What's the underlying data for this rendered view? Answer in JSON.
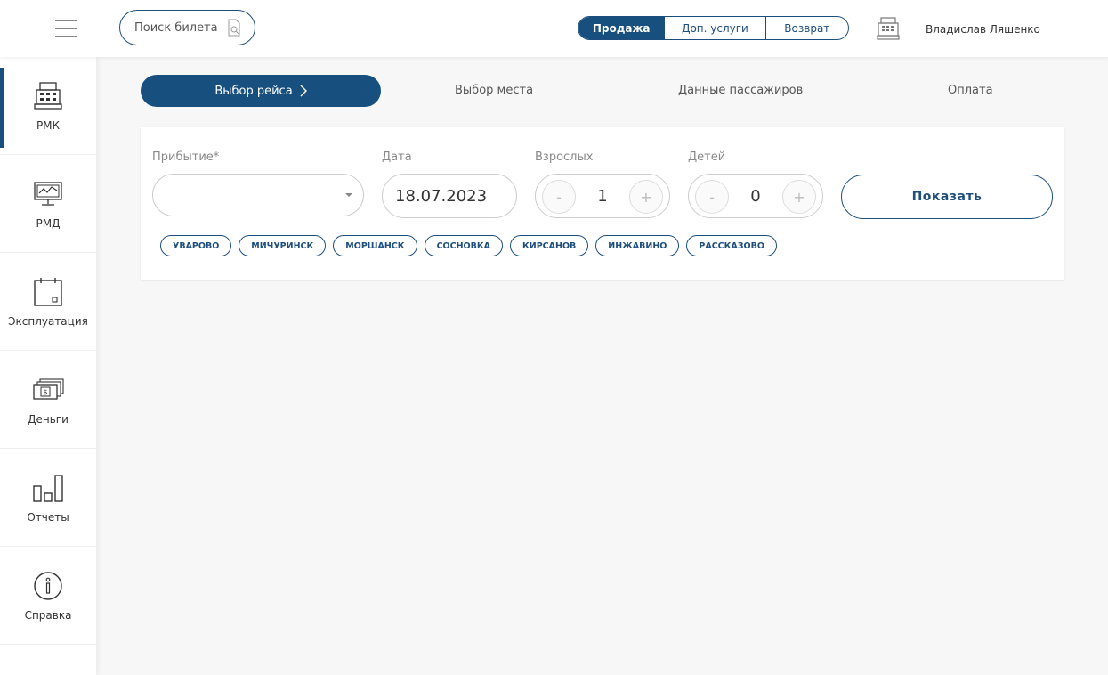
{
  "topbar": {
    "search_ticket_label": "Поиск билета",
    "modes": [
      {
        "label": "Продажа",
        "active": true
      },
      {
        "label": "Доп. услуги",
        "active": false
      },
      {
        "label": "Возврат",
        "active": false
      }
    ],
    "username": "Владислав Ляшенко"
  },
  "sidebar": {
    "items": [
      {
        "label": "РМК",
        "icon": "cash-register-icon",
        "active": true
      },
      {
        "label": "РМД",
        "icon": "monitor-icon",
        "active": false
      },
      {
        "label": "Эксплуатация",
        "icon": "calendar-icon",
        "active": false
      },
      {
        "label": "Деньги",
        "icon": "money-icon",
        "active": false
      },
      {
        "label": "Отчеты",
        "icon": "bar-chart-icon",
        "active": false
      },
      {
        "label": "Справка",
        "icon": "info-icon",
        "active": false
      }
    ]
  },
  "steps": {
    "items": [
      {
        "label": "Выбор рейса",
        "active": true
      },
      {
        "label": "Выбор места",
        "active": false
      },
      {
        "label": "Данные пассажиров",
        "active": false
      },
      {
        "label": "Оплата",
        "active": false
      }
    ]
  },
  "form": {
    "arrival_label": "Прибытие*",
    "arrival_value": "",
    "date_label": "Дата",
    "date_value": "18.07.2023",
    "adults_label": "Взрослых",
    "adults_value": "1",
    "children_label": "Детей",
    "children_value": "0",
    "minus": "-",
    "plus": "+",
    "show_button": "Показать"
  },
  "quick_destinations": [
    "УВАРОВО",
    "МИЧУРИНСК",
    "МОРШАНСК",
    "СОСНОВКА",
    "КИРСАНОВ",
    "ИНЖАВИНО",
    "РАССКАЗОВО"
  ],
  "colors": {
    "primary": "#17507f",
    "background": "#f7f7f7"
  }
}
